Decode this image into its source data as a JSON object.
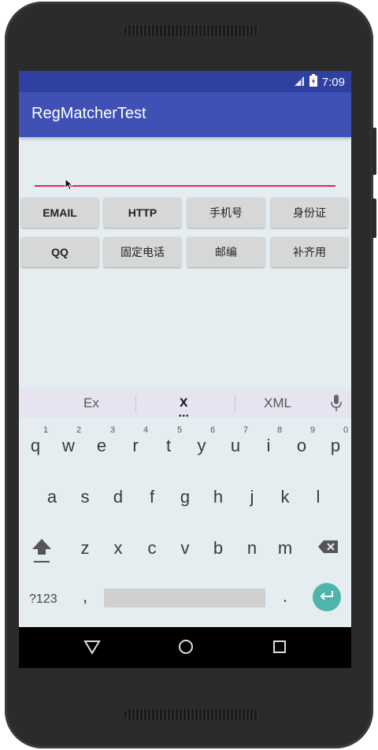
{
  "status": {
    "time": "7:09"
  },
  "appbar": {
    "title": "RegMatcherTest"
  },
  "buttons": {
    "row1": [
      "EMAIL",
      "HTTP",
      "手机号",
      "身份证"
    ],
    "row2": [
      "QQ",
      "固定电话",
      "邮编",
      "补齐用"
    ]
  },
  "keyboard": {
    "suggestions": [
      "Ex",
      "x",
      "XML"
    ],
    "row1": [
      "q",
      "w",
      "e",
      "r",
      "t",
      "y",
      "u",
      "i",
      "o",
      "p"
    ],
    "row1_hints": [
      "1",
      "2",
      "3",
      "4",
      "5",
      "6",
      "7",
      "8",
      "9",
      "0"
    ],
    "row2": [
      "a",
      "s",
      "d",
      "f",
      "g",
      "h",
      "j",
      "k",
      "l"
    ],
    "row3": [
      "z",
      "x",
      "c",
      "v",
      "b",
      "n",
      "m"
    ],
    "symbols_label": "?123",
    "comma": ",",
    "period": "."
  },
  "icons": {
    "signal": "signal-icon",
    "battery": "battery-icon",
    "shift": "shift-icon",
    "backspace": "backspace-icon",
    "mic": "mic-icon",
    "enter": "enter-icon",
    "back": "back-icon",
    "home": "home-icon",
    "recents": "recents-icon"
  },
  "colors": {
    "primary": "#3f51b5",
    "primary_dark": "#3040a0",
    "accent": "#e91e63",
    "enter": "#4db6ac"
  }
}
